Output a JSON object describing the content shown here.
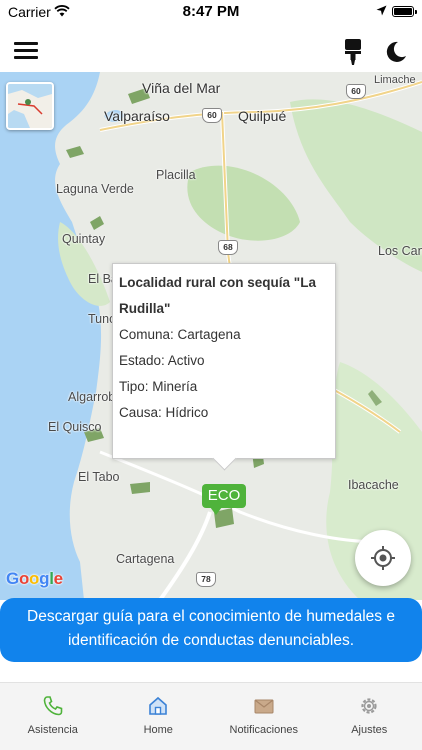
{
  "status_bar": {
    "carrier": "Carrier",
    "time": "8:47 PM"
  },
  "header": {
    "menu_icon": "menu-icon",
    "brush_icon": "paint-brush-icon",
    "theme_icon": "moon-icon"
  },
  "map": {
    "labels": {
      "vina_del_mar": "Viña del Mar",
      "limache": "Limache",
      "valparaiso": "Valparaíso",
      "quilpue": "Quilpué",
      "placilla": "Placilla",
      "laguna_verde": "Laguna Verde",
      "quintay": "Quintay",
      "los_cane": "Los Cane",
      "el_ba": "El Ba",
      "tunc": "Tunc",
      "algarrob": "Algarrob",
      "el_quisco": "El Quisco",
      "el_tabo": "El Tabo",
      "ibacache": "Ibacache",
      "cartagena": "Cartagena"
    },
    "shields": {
      "r60": "60",
      "r60b": "60",
      "r68": "68",
      "r78": "78"
    },
    "google": {
      "g": "G",
      "o1": "o",
      "o2": "o",
      "g2": "g",
      "l": "l",
      "e": "e"
    },
    "callout": {
      "title": "Localidad rural con sequía \"La Rudilla\"",
      "comuna": "Comuna: Cartagena",
      "estado": "Estado: Activo",
      "tipo": "Tipo: Minería",
      "causa": "Causa: Hídrico"
    },
    "marker": {
      "label": "ECO",
      "color": "#4fb33b"
    }
  },
  "banner": {
    "text": "Descargar guía para el conocimiento de humedales e identificación de conductas denunciables.",
    "color": "#1183ec"
  },
  "bottom_nav": {
    "items": [
      {
        "label": "Asistencia",
        "icon": "phone-icon"
      },
      {
        "label": "Home",
        "icon": "home-icon"
      },
      {
        "label": "Notificaciones",
        "icon": "envelope-icon"
      },
      {
        "label": "Ajustes",
        "icon": "gear-icon"
      }
    ]
  }
}
